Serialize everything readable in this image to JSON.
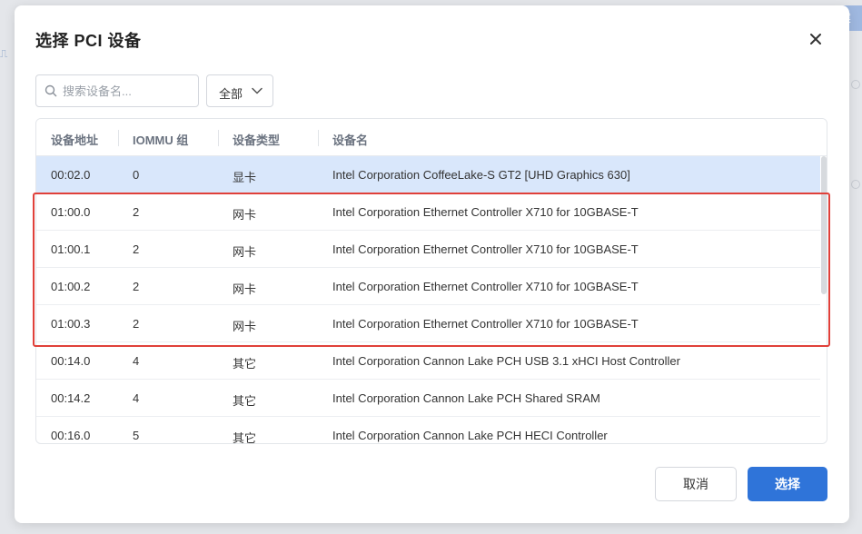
{
  "dialog": {
    "title": "选择 PCI 设备"
  },
  "background": {
    "button_label": "建"
  },
  "toolbar": {
    "search_placeholder": "搜索设备名...",
    "filter_value": "全部"
  },
  "table": {
    "columns": [
      "设备地址",
      "IOMMU 组",
      "设备类型",
      "设备名"
    ],
    "rows": [
      {
        "address": "00:02.0",
        "iommu": "0",
        "type": "显卡",
        "name": "Intel Corporation CoffeeLake-S GT2 [UHD Graphics 630]"
      },
      {
        "address": "01:00.0",
        "iommu": "2",
        "type": "网卡",
        "name": "Intel Corporation Ethernet Controller X710 for 10GBASE-T"
      },
      {
        "address": "01:00.1",
        "iommu": "2",
        "type": "网卡",
        "name": "Intel Corporation Ethernet Controller X710 for 10GBASE-T"
      },
      {
        "address": "01:00.2",
        "iommu": "2",
        "type": "网卡",
        "name": "Intel Corporation Ethernet Controller X710 for 10GBASE-T"
      },
      {
        "address": "01:00.3",
        "iommu": "2",
        "type": "网卡",
        "name": "Intel Corporation Ethernet Controller X710 for 10GBASE-T"
      },
      {
        "address": "00:14.0",
        "iommu": "4",
        "type": "其它",
        "name": "Intel Corporation Cannon Lake PCH USB 3.1 xHCI Host Controller"
      },
      {
        "address": "00:14.2",
        "iommu": "4",
        "type": "其它",
        "name": "Intel Corporation Cannon Lake PCH Shared SRAM"
      },
      {
        "address": "00:16.0",
        "iommu": "5",
        "type": "其它",
        "name": "Intel Corporation Cannon Lake PCH HECI Controller"
      }
    ]
  },
  "footer": {
    "cancel_label": "取消",
    "confirm_label": "选择"
  },
  "colors": {
    "accent": "#2f74d9",
    "selected_row": "#d9e7fb",
    "highlight_box": "#e0403a"
  }
}
